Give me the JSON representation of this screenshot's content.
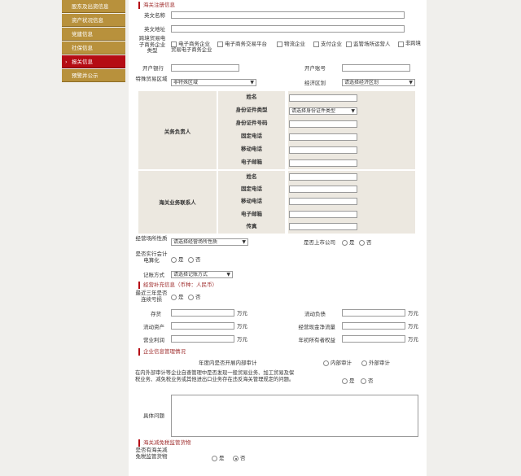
{
  "sidebar": {
    "items": [
      {
        "label": "股东及出资信息",
        "active": false
      },
      {
        "label": "资产状况信息",
        "active": false
      },
      {
        "label": "党建信息",
        "active": false
      },
      {
        "label": "社保信息",
        "active": false
      },
      {
        "label": "报关信息",
        "active": true
      },
      {
        "label": "预警并公示",
        "active": false
      }
    ]
  },
  "registration": {
    "section_title": "海关注册信息",
    "english_name_label": "英文名称",
    "english_address_label": "英文地址",
    "ecommerce_type_label": "跨境贸易电子商务企业类型",
    "ecommerce_types": [
      "电子商务企业",
      "电子商务交易平台",
      "物流企业",
      "支付企业",
      "监管场所运营人",
      "非跨境贸易电子商务企业"
    ],
    "bank_label": "开户银行",
    "account_label": "开户账号",
    "special_zone_label": "特殊贸易区域",
    "special_zone_value": "非特殊区域",
    "economic_zone_label": "经济区划",
    "economic_zone_value": "请选择经济区划"
  },
  "customs_contact": {
    "principal_group": "关务负责人",
    "principal_fields": [
      "姓名",
      "身份证件类型",
      "身份证件号码",
      "固定电话",
      "移动电话",
      "电子邮箱"
    ],
    "id_type_placeholder": "请选择身份证件类型",
    "contact_group": "海关业务联系人",
    "contact_fields": [
      "姓名",
      "固定电话",
      "移动电话",
      "电子邮箱",
      "传真"
    ]
  },
  "business": {
    "premises_label": "经营场所性质",
    "premises_value": "请选择经营场所性质",
    "listed_label": "是否上市公司",
    "computerized_label": "是否实行会计电算化",
    "bookkeeping_label": "记账方式",
    "bookkeeping_value": "请选择记账方式",
    "yes": "是",
    "no": "否"
  },
  "finance": {
    "section_title": "经营补充信息（币种：人民币）",
    "loss_label": "最近三年是否连续亏损",
    "inventory_label": "存货",
    "current_liab_label": "流动负债",
    "current_assets_label": "流动资产",
    "net_cash_label": "经营现金净流量",
    "operating_profit_label": "营业利润",
    "equity_label": "年初所有者权益",
    "unit": "万元"
  },
  "credit": {
    "section_title": "企业信息管理情况",
    "audit_question": "年度内是否开展内部审计",
    "internal_audit": "内部审计",
    "external_audit": "外部审计",
    "violation_paragraph": "在内外部审计等企业自查管理中是否发现一般贸易业务、加工贸易及保税业务、减免税业务或其他进出口业务存在违反海关管理规定的问题。",
    "detail_label": "具体问题",
    "yes": "是",
    "no": "否"
  },
  "exemption": {
    "section_title": "海关减免税监管货物",
    "question_label": "是否有海关减免税监管货物",
    "yes": "是",
    "no": "否"
  }
}
